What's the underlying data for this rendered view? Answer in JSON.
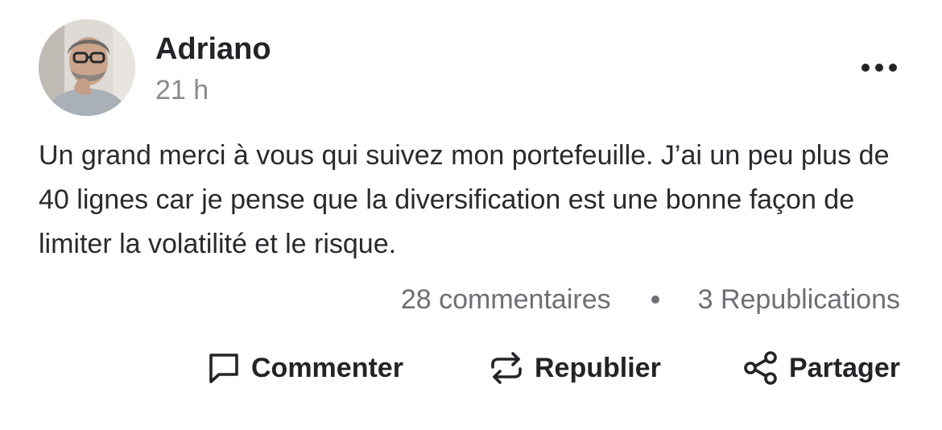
{
  "post": {
    "author": "Adriano",
    "time": "21 h",
    "text": "Un grand merci à vous qui suivez mon portefeuille. J’ai un peu plus de 40 lignes car je pense que la diversification est une bonne façon de limiter la volatilité et le risque.",
    "comments": "28 commentaires",
    "reposts": "3 Republications"
  },
  "actions": {
    "comment_label": "Commenter",
    "repost_label": "Republier",
    "share_label": "Partager"
  },
  "icons": {
    "more": "more-horizontal-icon",
    "comment": "speech-bubble-icon",
    "repost": "repost-arrows-icon",
    "share": "share-nodes-icon"
  },
  "colors": {
    "text": "#242428",
    "muted": "#8a8a90",
    "stats": "#6e6e74",
    "background": "#ffffff"
  }
}
